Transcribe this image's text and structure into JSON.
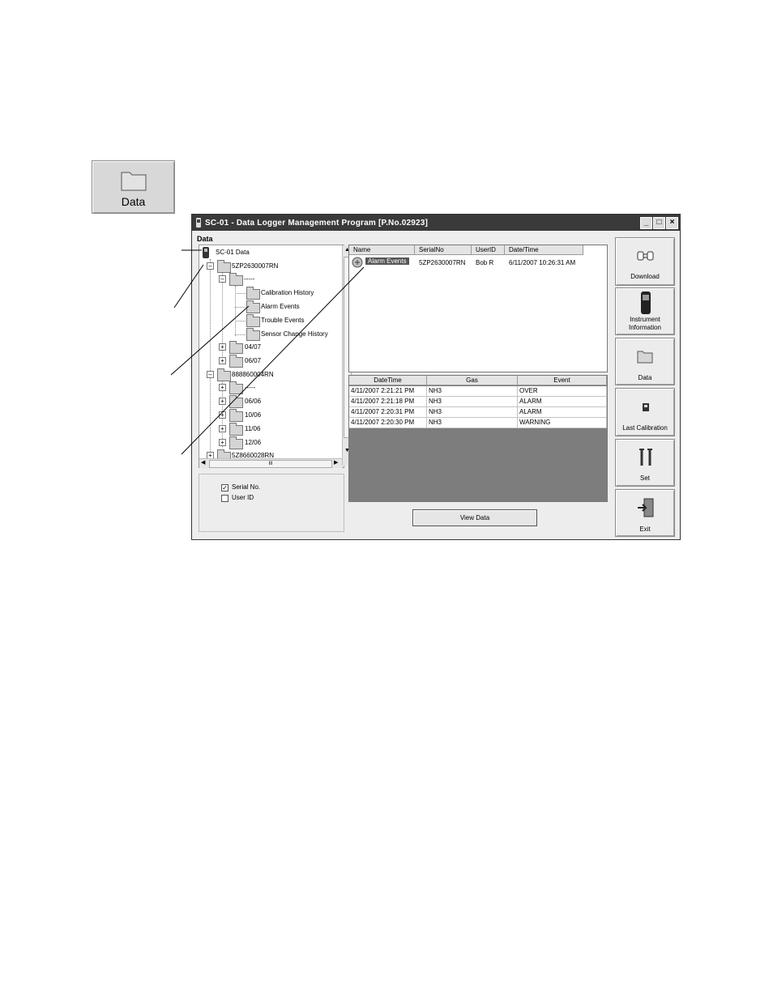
{
  "big_button": {
    "label": "Data"
  },
  "window": {
    "title": "SC-01 - Data Logger Management Program [P.No.02923]",
    "section_label": "Data",
    "controls": {
      "minimize": "_",
      "maximize": "□",
      "close": "×"
    }
  },
  "tree": {
    "root": "SC-01 Data",
    "instrument1": "5ZP2630007RN",
    "subfolder_dash": "-----",
    "calibration": "Calibration History",
    "alarm": "Alarm Events",
    "trouble": "Trouble Events",
    "sensor": "Sensor Change History",
    "f0407": "04/07",
    "f0607": "06/07",
    "instrument2": "888860004RN",
    "sub_dash2": "-----",
    "f0606": "06/06",
    "f1006": "10/06",
    "f1106": "11/06",
    "f1206": "12/06",
    "instrument3": "5Z8660028RN",
    "hscroll_thumb": "III"
  },
  "options": {
    "serial_label": "Serial No.",
    "serial_checked": true,
    "userid_label": "User ID",
    "userid_checked": false
  },
  "file_list": {
    "columns": [
      "Name",
      "SerialNo",
      "UserID",
      "Date/Time"
    ],
    "row": {
      "name": "Alarm Events",
      "serial": "5ZP2630007RN",
      "user": "Bob R",
      "datetime": "6/11/2007 10:26:31 AM"
    }
  },
  "events": {
    "columns": [
      "DateTime",
      "Gas",
      "Event"
    ],
    "rows": [
      {
        "datetime": "4/11/2007 2:21:21 PM",
        "gas": "NH3",
        "event": "OVER"
      },
      {
        "datetime": "4/11/2007 2:21:18 PM",
        "gas": "NH3",
        "event": "ALARM"
      },
      {
        "datetime": "4/11/2007 2:20:31 PM",
        "gas": "NH3",
        "event": "ALARM"
      },
      {
        "datetime": "4/11/2007 2:20:30 PM",
        "gas": "NH3",
        "event": "WARNING"
      }
    ]
  },
  "view_data_label": "View Data",
  "toolbar": {
    "download": "Download",
    "instrument_info_1": "Instrument",
    "instrument_info_2": "Information",
    "data": "Data",
    "last_calibration": "Last Calibration",
    "set": "Set",
    "exit": "Exit"
  }
}
